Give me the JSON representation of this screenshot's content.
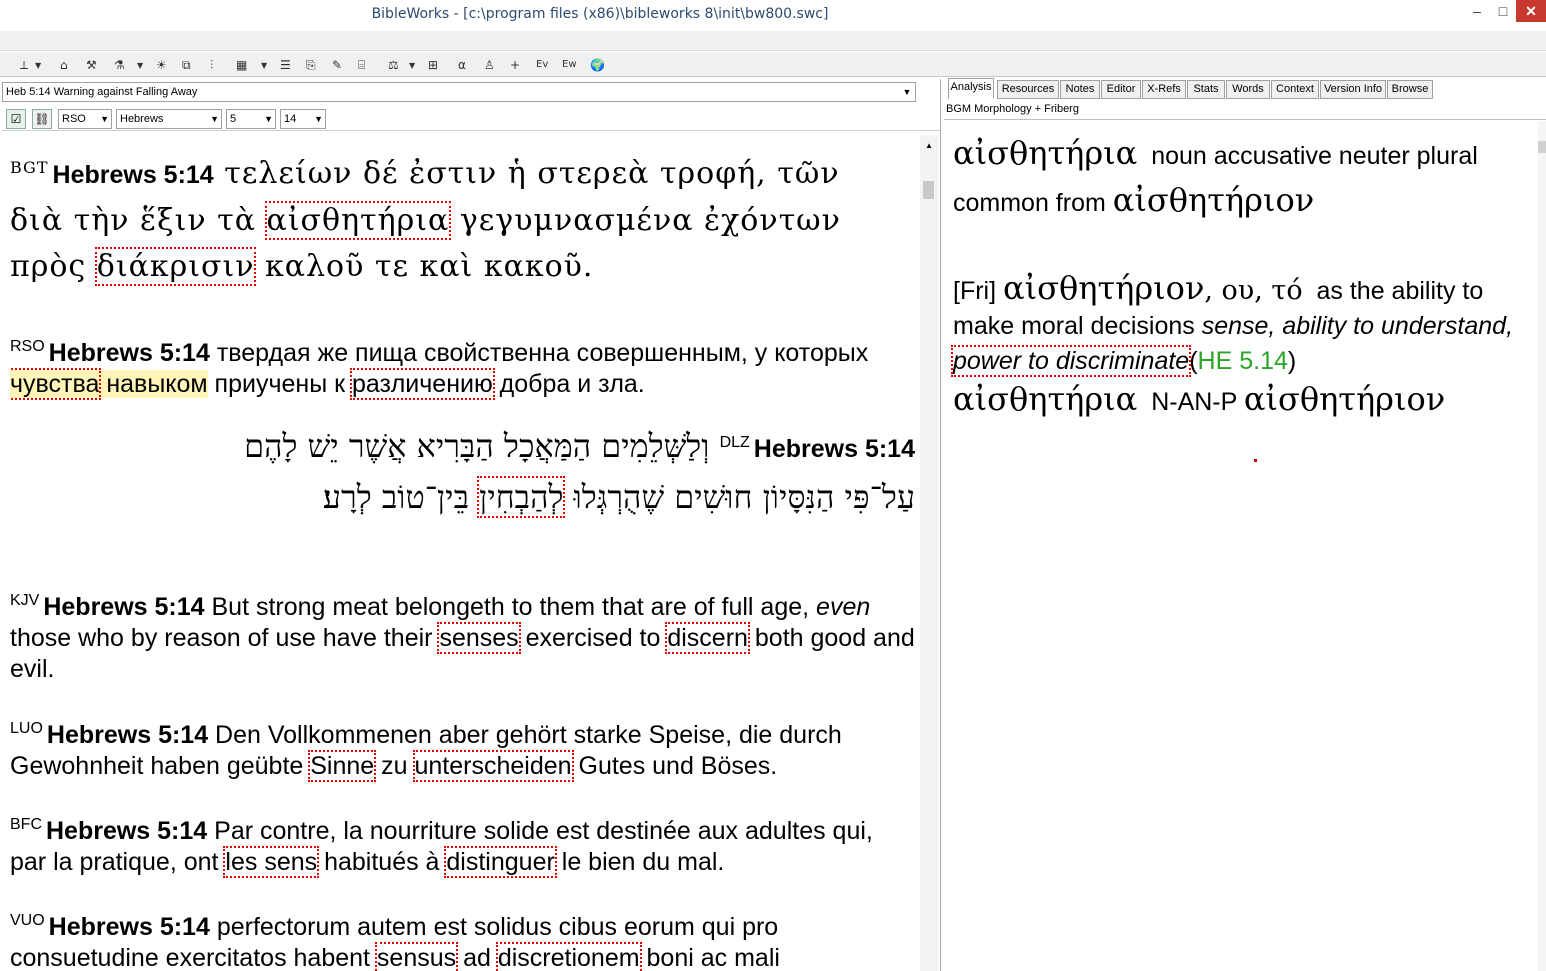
{
  "window": {
    "title": "BibleWorks - [c:\\program files (x86)\\bibleworks 8\\init\\bw800.swc]",
    "controls": [
      "–",
      "□",
      "✕"
    ]
  },
  "toolbar": {
    "items": [
      "⟂",
      "⌂",
      "⚒",
      "⚗",
      "☀",
      "⧉",
      "⫶",
      "▦",
      "☰",
      "⎘",
      "✎",
      "⌸",
      "⚖",
      "⊞",
      "α",
      "♙",
      "+",
      "Ev",
      "Ew",
      "🌍"
    ]
  },
  "left": {
    "reference_bar": "Heb 5:14 Warning against Falling Away",
    "version_combo": "RSO",
    "book_combo": "Hebrews",
    "chapter_combo": "5",
    "verse_combo": "14",
    "verses": [
      {
        "code": "BGT",
        "ref": "Hebrews 5:14",
        "line1": "τελείων δέ ἐστιν ἡ στερεὰ τροφή, τῶν",
        "line2_a": "διὰ τὴν ἕξιν τὰ ",
        "line2_hl": "αἰσθητήρια",
        "line2_b": " γεγυμνασμένα ἐχόντων",
        "line3_a": "πρὸς ",
        "line3_hl": "διάκρισιν",
        "line3_b": " καλοῦ τε καὶ κακοῦ."
      },
      {
        "code": "RSO",
        "ref": "Hebrews 5:14",
        "text_a": " твердая же пища свойственна совершенным, у которых ",
        "hl1": "чувства",
        "yel": " навыком",
        "text_b": " приучены к ",
        "hl2": "различению",
        "text_c": " добра и зла."
      },
      {
        "code": "DLZ",
        "ref": "Hebrews 5:14",
        "line1": "וְלַשְּׁלֵמִים הַמַּאֲכָל הַבָּרִיא אֲשֶׁר יֵשׁ לָהֶם",
        "line2_a": "עַל־פִּי הַנִּסָּיוֹן חוּשִׁים שֶׁהֻרְגְּלוּ ",
        "line2_hl": "לְהַבְחִין",
        "line2_b": " בֵּין־טוֹב לְרָע׃"
      },
      {
        "code": "KJV",
        "ref": "Hebrews 5:14",
        "text_a": " But strong meat belongeth to them that are of full age, ",
        "italic": "even",
        "text_b": " those who by reason of use have their ",
        "hl1": "senses",
        "text_c": " exercised to ",
        "hl2": "discern",
        "text_d": " both good and evil."
      },
      {
        "code": "LUO",
        "ref": "Hebrews 5:14",
        "text_a": " Den Vollkommenen aber gehört starke Speise, die durch Gewohnheit haben geübte ",
        "hl1": "Sinne",
        "text_b": " zu ",
        "hl2": "unterscheiden",
        "text_c": " Gutes und Böses."
      },
      {
        "code": "BFC",
        "ref": "Hebrews 5:14",
        "text_a": " Par contre, la nourriture solide est destinée aux adultes qui, par la pratique, ont ",
        "hl1": "les sens",
        "text_b": " habitués à ",
        "hl2": "distinguer",
        "text_c": " le bien du mal."
      },
      {
        "code": "VUO",
        "ref": "Hebrews 5:14",
        "text_a": " perfectorum autem est solidus cibus eorum qui pro consuetudine exercitatos habent ",
        "hl1": "sensus",
        "text_b": " ad ",
        "hl2": "discretionem",
        "text_c": " boni ac mali"
      }
    ]
  },
  "right": {
    "tabs": [
      "Analysis",
      "Resources",
      "Notes",
      "Editor",
      "X-Refs",
      "Stats",
      "Words",
      "Context",
      "Version Info",
      "Browse"
    ],
    "active_tab": "Analysis",
    "subtitle": "BGM Morphology + Friberg",
    "word": "αἰσθητήρια",
    "parse": "noun accusative neuter plural common from",
    "lemma": "αἰσθητήριον",
    "fri_label": "[Fri]",
    "fri_lemma": "αἰσθητήριον",
    "fri_forms": ", ου, τό",
    "fri_def": "as the ability to make moral decisions",
    "fri_gloss_a": "sense, ability to understand,",
    "fri_gloss_hl": "power to discriminate",
    "fri_ref": "HE 5.14",
    "morph_word": "αἰσθητήρια",
    "morph_code": "N-AN-P",
    "morph_lemma": "αἰσθητήριον",
    "link_color": "#2aa52a",
    "highlight_color": "#e00000"
  }
}
